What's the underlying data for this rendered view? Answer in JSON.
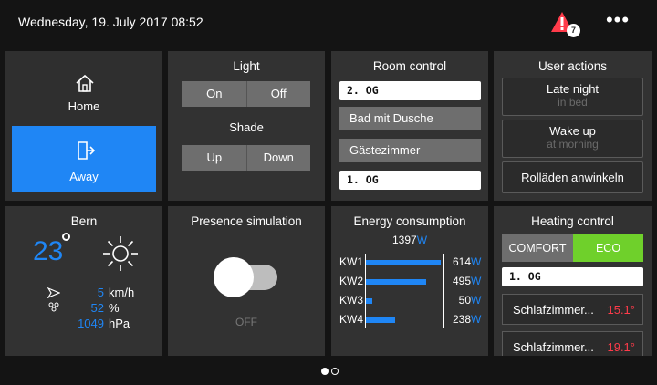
{
  "header": {
    "datetime": "Wednesday, 19. July 2017 08:52",
    "alert_count": "7",
    "menu_label": "•••"
  },
  "colors": {
    "accent": "#1f86f5",
    "eco": "#6fd02b",
    "alert": "#ff3b4a",
    "tile": "#323232"
  },
  "presence_mode": {
    "home_label": "Home",
    "away_label": "Away",
    "active": "Away"
  },
  "light": {
    "title": "Light",
    "on_label": "On",
    "off_label": "Off",
    "shade_title": "Shade",
    "up_label": "Up",
    "down_label": "Down"
  },
  "room_control": {
    "title": "Room control",
    "floor_top": "2. OG",
    "rooms": [
      "Bad mit Dusche",
      "Gästezimmer"
    ],
    "floor_bottom": "1. OG"
  },
  "user_actions": {
    "title": "User actions",
    "items": [
      {
        "label": "Late night",
        "sub": "in bed"
      },
      {
        "label": "Wake up",
        "sub": "at morning"
      },
      {
        "label": "Rolläden anwinkeln",
        "sub": ""
      }
    ]
  },
  "weather": {
    "city": "Bern",
    "temperature": "23",
    "icon": "sun-icon",
    "wind_value": "5",
    "wind_unit": "km/h",
    "humidity_value": "52",
    "humidity_unit": "%",
    "pressure_value": "1049",
    "pressure_unit": "hPa"
  },
  "presence_simulation": {
    "title": "Presence simulation",
    "state": "OFF"
  },
  "energy": {
    "title": "Energy consumption",
    "total_value": "1397",
    "unit": "W",
    "max": 614,
    "rows": [
      {
        "label": "KW1",
        "value": 614,
        "value_text": "614"
      },
      {
        "label": "KW2",
        "value": 495,
        "value_text": "495"
      },
      {
        "label": "KW3",
        "value": 50,
        "value_text": "50"
      },
      {
        "label": "KW4",
        "value": 238,
        "value_text": "238"
      }
    ]
  },
  "heating": {
    "title": "Heating control",
    "comfort_label": "COMFORT",
    "eco_label": "ECO",
    "active_mode": "ECO",
    "floor": "1. OG",
    "rooms": [
      {
        "name": "Schlafzimmer...",
        "temp": "15.1°"
      },
      {
        "name": "Schlafzimmer...",
        "temp": "19.1°"
      }
    ]
  },
  "pager": {
    "pages": 2,
    "current": 1
  }
}
